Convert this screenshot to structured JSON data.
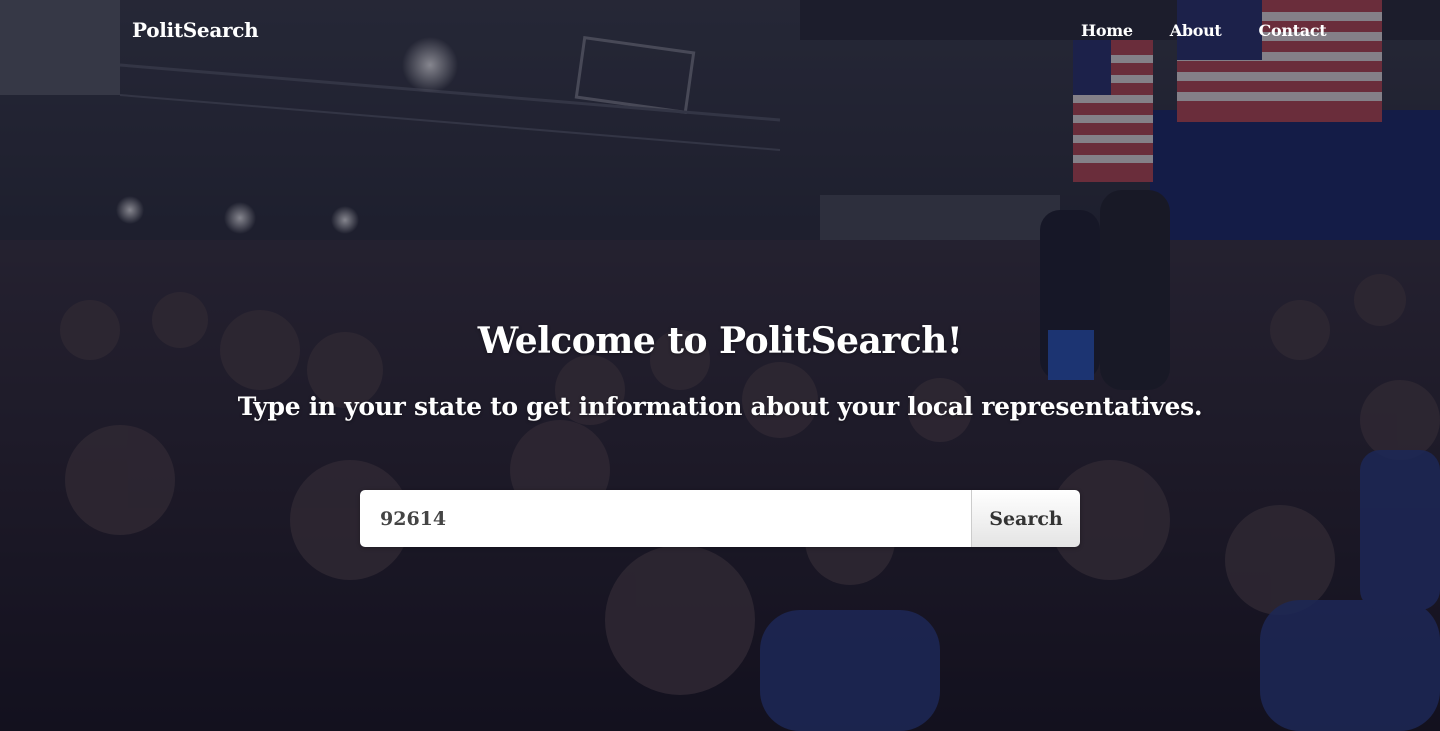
{
  "navbar": {
    "brand": "PolitSearch",
    "links": [
      {
        "label": "Home"
      },
      {
        "label": "About"
      },
      {
        "label": "Contact"
      }
    ]
  },
  "main": {
    "heading": "Welcome to PolitSearch!",
    "subheading": "Type in your state to get information about your local representatives.",
    "search": {
      "value": "92614",
      "button_label": "Search"
    }
  },
  "background": {
    "description_icon": "crowd-rally-photo",
    "overlay_color": "#0a0c1c"
  }
}
